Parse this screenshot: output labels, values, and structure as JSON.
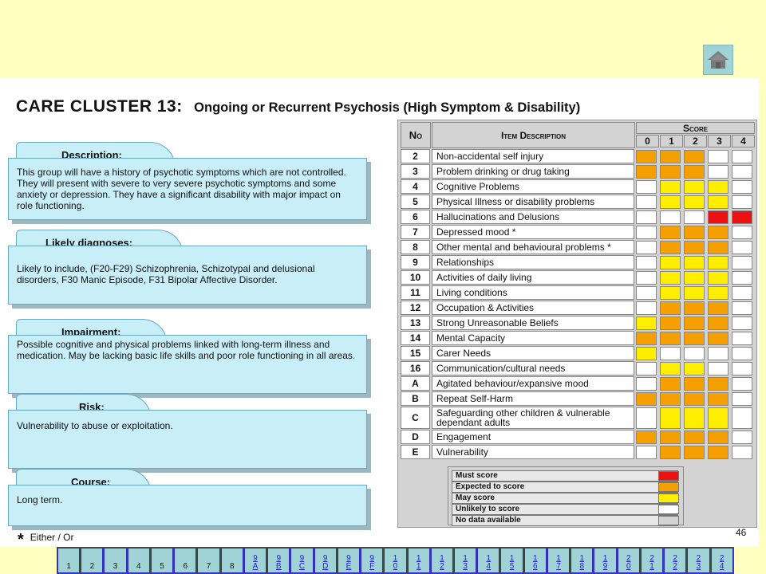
{
  "title": {
    "cluster": "CARE CLUSTER 13:",
    "subtitle": "Ongoing or Recurrent Psychosis (High Symptom & Disability)"
  },
  "sections": [
    {
      "heading": "Description:",
      "text": "This group will have a history of psychotic symptoms which are not controlled.  They will present with severe to very severe psychotic symptoms and some anxiety or depression.  They have a significant disability with major impact on role functioning."
    },
    {
      "heading": "Likely diagnoses:",
      "text": "Likely to include, (F20-F29) Schizophrenia, Schizotypal and delusional disorders, F30 Manic Episode, F31 Bipolar Affective Disorder."
    },
    {
      "heading": "Impairment:",
      "text": "Possible cognitive and physical problems linked with long-term illness and medication.  May be lacking basic life skills and poor role functioning in all areas."
    },
    {
      "heading": "Risk:",
      "text": "Vulnerability to abuse or exploitation."
    },
    {
      "heading": "Course:",
      "text": "Long term."
    }
  ],
  "table": {
    "col_no": "No",
    "col_desc": "Item Description",
    "col_score": "Score",
    "score_levels": [
      "0",
      "1",
      "2",
      "3",
      "4"
    ],
    "rows": [
      {
        "no": "2",
        "desc": "Non-accidental self injury",
        "scores": [
          "expected",
          "expected",
          "expected",
          "unlikely",
          "unlikely"
        ]
      },
      {
        "no": "3",
        "desc": "Problem drinking or drug taking",
        "scores": [
          "expected",
          "expected",
          "expected",
          "unlikely",
          "unlikely"
        ]
      },
      {
        "no": "4",
        "desc": "Cognitive Problems",
        "scores": [
          "unlikely",
          "may",
          "may",
          "may",
          "unlikely"
        ]
      },
      {
        "no": "5",
        "desc": "Physical Illness or disability problems",
        "scores": [
          "unlikely",
          "may",
          "may",
          "may",
          "unlikely"
        ]
      },
      {
        "no": "6",
        "desc": "Hallucinations and Delusions",
        "scores": [
          "unlikely",
          "unlikely",
          "unlikely",
          "must",
          "must"
        ]
      },
      {
        "no": "7",
        "desc": "Depressed mood *",
        "scores": [
          "unlikely",
          "expected",
          "expected",
          "expected",
          "unlikely"
        ]
      },
      {
        "no": "8",
        "desc": "Other mental and behavioural problems *",
        "scores": [
          "unlikely",
          "expected",
          "expected",
          "expected",
          "unlikely"
        ]
      },
      {
        "no": "9",
        "desc": "Relationships",
        "scores": [
          "unlikely",
          "may",
          "may",
          "may",
          "unlikely"
        ]
      },
      {
        "no": "10",
        "desc": "Activities of daily living",
        "scores": [
          "unlikely",
          "may",
          "may",
          "may",
          "unlikely"
        ]
      },
      {
        "no": "11",
        "desc": "Living conditions",
        "scores": [
          "unlikely",
          "may",
          "may",
          "may",
          "unlikely"
        ]
      },
      {
        "no": "12",
        "desc": "Occupation & Activities",
        "scores": [
          "unlikely",
          "expected",
          "expected",
          "expected",
          "unlikely"
        ]
      },
      {
        "no": "13",
        "desc": "Strong Unreasonable Beliefs",
        "scores": [
          "may",
          "expected",
          "expected",
          "expected",
          "unlikely"
        ]
      },
      {
        "no": "14",
        "desc": "Mental Capacity",
        "scores": [
          "expected",
          "expected",
          "expected",
          "expected",
          "unlikely"
        ]
      },
      {
        "no": "15",
        "desc": "Carer Needs",
        "scores": [
          "may",
          "unlikely",
          "unlikely",
          "unlikely",
          "unlikely"
        ]
      },
      {
        "no": "16",
        "desc": "Communication/cultural needs",
        "scores": [
          "unlikely",
          "may",
          "may",
          "unlikely",
          "unlikely"
        ]
      },
      {
        "no": "A",
        "desc": "Agitated behaviour/expansive mood",
        "scores": [
          "unlikely",
          "expected",
          "expected",
          "expected",
          "unlikely"
        ]
      },
      {
        "no": "B",
        "desc": "Repeat Self-Harm",
        "scores": [
          "expected",
          "expected",
          "expected",
          "expected",
          "unlikely"
        ]
      },
      {
        "no": "C",
        "desc": "Safeguarding other children & vulnerable dependant adults",
        "scores": [
          "unlikely",
          "may",
          "may",
          "may",
          "unlikely"
        ]
      },
      {
        "no": "D",
        "desc": "Engagement",
        "scores": [
          "expected",
          "expected",
          "expected",
          "expected",
          "unlikely"
        ]
      },
      {
        "no": "E",
        "desc": "Vulnerability",
        "scores": [
          "unlikely",
          "expected",
          "expected",
          "expected",
          "unlikely"
        ]
      }
    ]
  },
  "legend": [
    {
      "key": "must",
      "label": "Must score",
      "color": "#ee1111"
    },
    {
      "key": "expected",
      "label": "Expected to score",
      "color": "#f5a000"
    },
    {
      "key": "may",
      "label": "May score",
      "color": "#ffee00"
    },
    {
      "key": "unlikely",
      "label": "Unlikely to score",
      "color": "#ffffff"
    },
    {
      "key": "nodata",
      "label": "No data available",
      "color": "#d3d3d3"
    }
  ],
  "footnote": "Either / Or",
  "footnote_mark": "*",
  "page_number": "46",
  "nav": [
    {
      "label": "1",
      "link": false
    },
    {
      "label": "2",
      "link": false
    },
    {
      "label": "3",
      "link": false
    },
    {
      "label": "4",
      "link": false
    },
    {
      "label": "5",
      "link": false
    },
    {
      "label": "6",
      "link": false
    },
    {
      "label": "7",
      "link": false
    },
    {
      "label": "8",
      "link": false
    },
    {
      "label": "9A",
      "link": true
    },
    {
      "label": "9B",
      "link": true
    },
    {
      "label": "9C",
      "link": true
    },
    {
      "label": "9D",
      "link": true
    },
    {
      "label": "9E",
      "link": true
    },
    {
      "label": "9F",
      "link": true
    },
    {
      "label": "10",
      "link": true
    },
    {
      "label": "11",
      "link": true
    },
    {
      "label": "12",
      "link": true
    },
    {
      "label": "13",
      "link": true
    },
    {
      "label": "14",
      "link": true
    },
    {
      "label": "15",
      "link": true
    },
    {
      "label": "16",
      "link": true
    },
    {
      "label": "17",
      "link": true
    },
    {
      "label": "18",
      "link": true
    },
    {
      "label": "19",
      "link": true
    },
    {
      "label": "20",
      "link": true
    },
    {
      "label": "21",
      "link": true
    },
    {
      "label": "22",
      "link": true
    },
    {
      "label": "23",
      "link": true
    },
    {
      "label": "24",
      "link": true
    }
  ],
  "icons": {
    "home": "home-icon"
  }
}
